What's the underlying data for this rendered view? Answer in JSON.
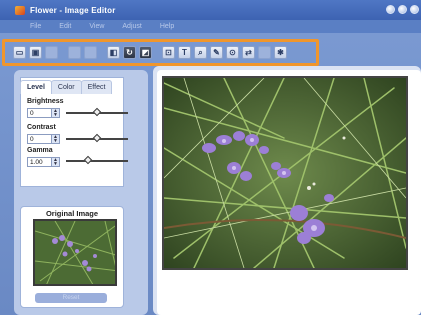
{
  "window": {
    "title": "Flower - Image Editor",
    "accent_color": "#4f77c4"
  },
  "menu": [
    "File",
    "Edit",
    "View",
    "Adjust",
    "Help"
  ],
  "toolbar": {
    "buttons": [
      {
        "icon": "open-icon",
        "state": "enabled"
      },
      {
        "icon": "save-icon",
        "state": "enabled"
      },
      {
        "icon": "undo-icon",
        "state": "disabled"
      },
      {
        "icon": "redo-icon",
        "state": "disabled"
      },
      {
        "icon": "cut-icon",
        "state": "disabled"
      },
      {
        "icon": "crop-icon",
        "state": "enabled"
      },
      {
        "icon": "rotate-icon",
        "state": "enabled"
      },
      {
        "icon": "flip-icon",
        "state": "enabled"
      },
      {
        "icon": "resize-icon",
        "state": "enabled"
      },
      {
        "icon": "text-tool-icon",
        "glyph": "T",
        "state": "enabled"
      },
      {
        "icon": "zoom-icon",
        "state": "enabled"
      },
      {
        "icon": "brush-icon",
        "state": "enabled"
      },
      {
        "icon": "redeye-icon",
        "state": "enabled"
      },
      {
        "icon": "compare-icon",
        "state": "enabled"
      },
      {
        "icon": "frame-icon",
        "state": "disabled"
      },
      {
        "icon": "settings-icon",
        "state": "enabled"
      }
    ]
  },
  "adjust_panel": {
    "tabs": [
      {
        "label": "Level",
        "active": true
      },
      {
        "label": "Color",
        "active": false
      },
      {
        "label": "Effect",
        "active": false
      }
    ],
    "controls": [
      {
        "label": "Brightness",
        "value": "0",
        "slider_fraction": 0.5
      },
      {
        "label": "Contrast",
        "value": "0",
        "slider_fraction": 0.5
      },
      {
        "label": "Gamma",
        "value": "1.00",
        "slider_fraction": 0.35
      }
    ]
  },
  "original_panel": {
    "title": "Original Image",
    "reset_label": "Reset"
  }
}
